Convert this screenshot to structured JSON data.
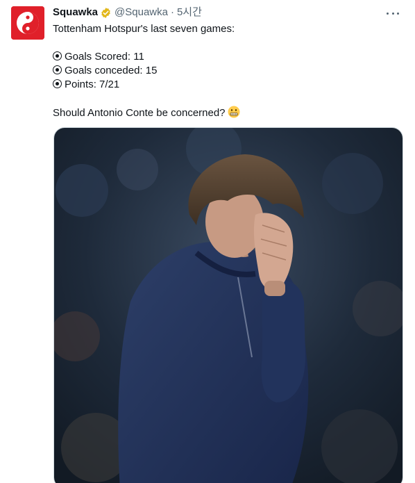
{
  "tweet": {
    "display_name": "Squawka",
    "handle": "@Squawka",
    "separator": "·",
    "time": "5시간",
    "lines": {
      "intro": "Tottenham Hotspur's last seven games:",
      "goals_scored": "Goals Scored: 11",
      "goals_conceded": "Goals conceded: 15",
      "points": "Points: 7/21",
      "question": "Should Antonio Conte be concerned?"
    }
  },
  "icons": {
    "avatar": "squawka-logo",
    "verified": "verified-badge-icon",
    "more": "more-options-icon",
    "bullet": "radio-bullet-icon",
    "emoji": "grimacing-face-emoji"
  },
  "colors": {
    "brand_red": "#e0202a",
    "verified_gold": "#e2b719",
    "secondary_text": "#536471"
  }
}
